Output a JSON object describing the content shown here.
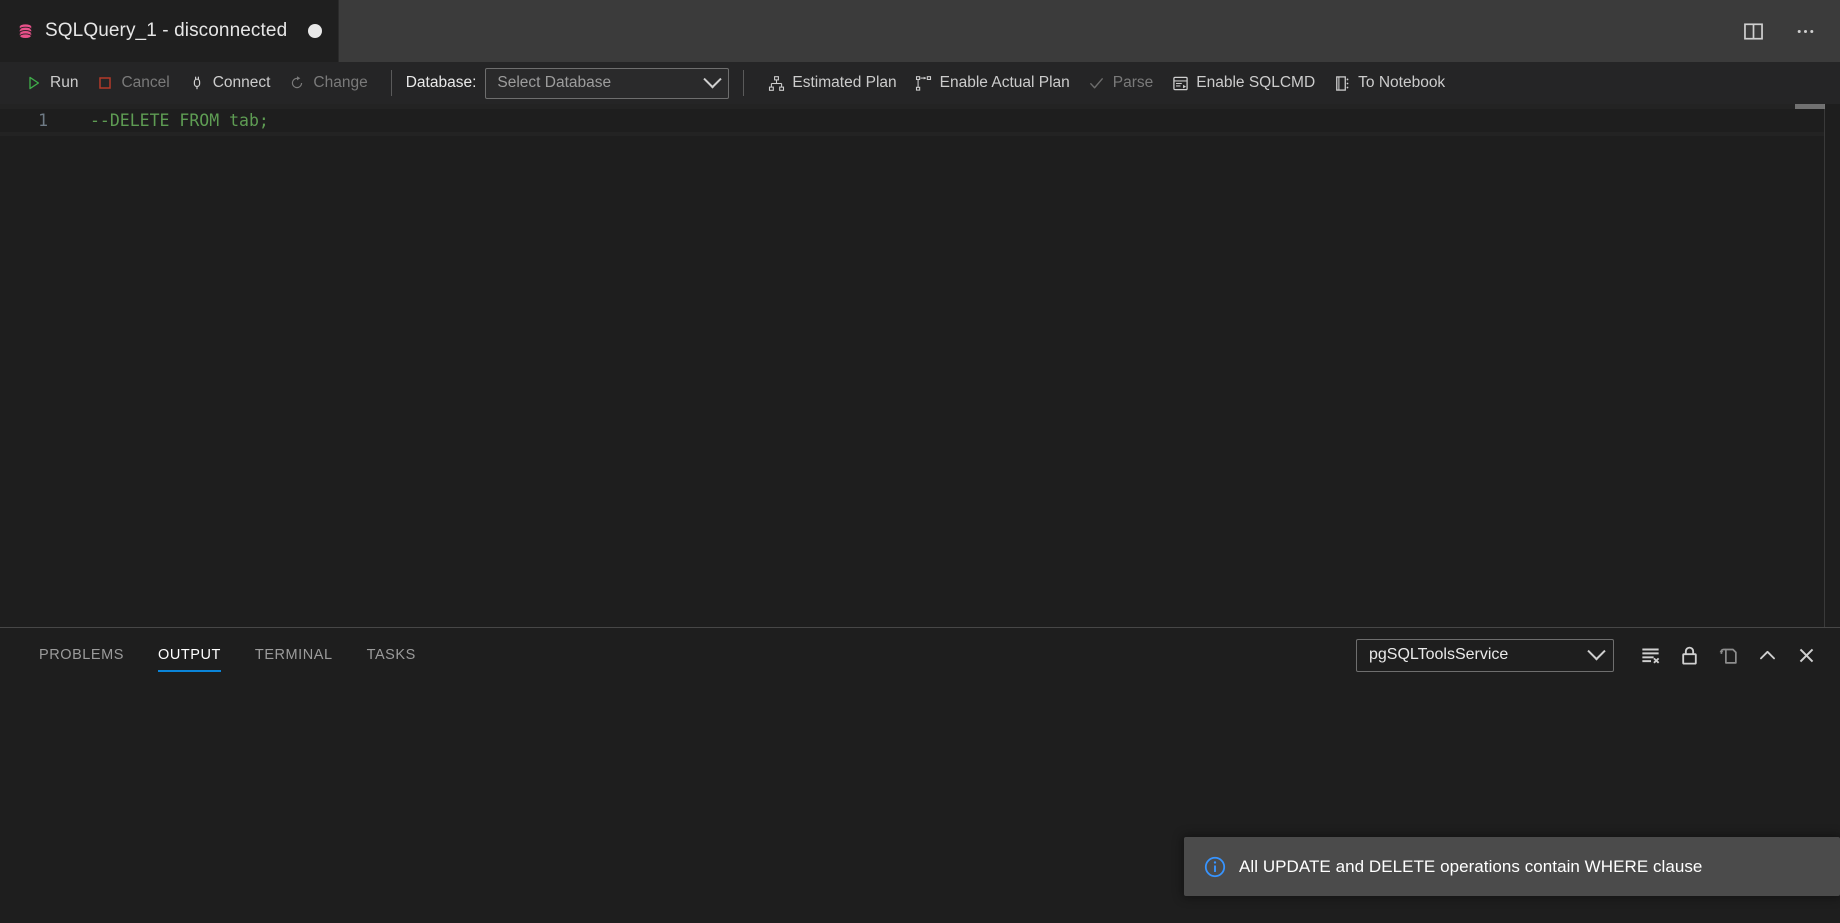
{
  "window": {
    "title": "SQLQuery_1 - disconnected"
  },
  "tabbar": {
    "tabs": [
      {
        "label": "SQLQuery_1 - disconnected",
        "icon": "database-icon",
        "dirty": true,
        "active": true
      }
    ],
    "actions": [
      {
        "name": "split-editor-icon",
        "title": "Split Editor"
      },
      {
        "name": "more-actions-icon",
        "title": "More Actions..."
      }
    ]
  },
  "editor_toolbar": {
    "run_label": "Run",
    "cancel_label": "Cancel",
    "connect_label": "Connect",
    "change_label": "Change",
    "database_label": "Database:",
    "database_value": "Select Database",
    "estimated_plan_label": "Estimated Plan",
    "enable_actual_plan_label": "Enable Actual Plan",
    "parse_label": "Parse",
    "enable_sqlcmd_label": "Enable SQLCMD",
    "to_notebook_label": "To Notebook"
  },
  "editor": {
    "lines": [
      {
        "number": "1",
        "text": "--DELETE FROM tab;",
        "token": "comment"
      }
    ]
  },
  "panel": {
    "tabs": [
      {
        "label": "Problems",
        "active": false
      },
      {
        "label": "Output",
        "active": true
      },
      {
        "label": "Terminal",
        "active": false
      },
      {
        "label": "Tasks",
        "active": false
      }
    ],
    "output_channel": "pgSQLToolsService",
    "actions": [
      {
        "name": "clear-output-icon",
        "title": "Clear Output"
      },
      {
        "name": "lock-scroll-icon",
        "title": "Turn Auto Scrolling Off"
      },
      {
        "name": "open-in-editor-icon",
        "title": "Open Output in Editor"
      },
      {
        "name": "maximize-panel-icon",
        "title": "Maximize Panel Size"
      },
      {
        "name": "close-panel-icon",
        "title": "Close Panel"
      }
    ],
    "body_text": ""
  },
  "notification": {
    "icon": "info-icon",
    "message": "All UPDATE and DELETE operations contain WHERE clause"
  },
  "colors": {
    "accent_blue": "#0a84d8",
    "tab_icon_pink": "#e8518a",
    "run_green": "#3fae4a",
    "cancel_red": "#b33a28",
    "comment_green": "#5e9c53",
    "line_number": "#6f7b86",
    "toast_bg": "#4b4b4b",
    "editor_bg": "#1e1e1e",
    "tabbar_bg": "#3b3b3b",
    "toolbar_bg": "#252526"
  }
}
